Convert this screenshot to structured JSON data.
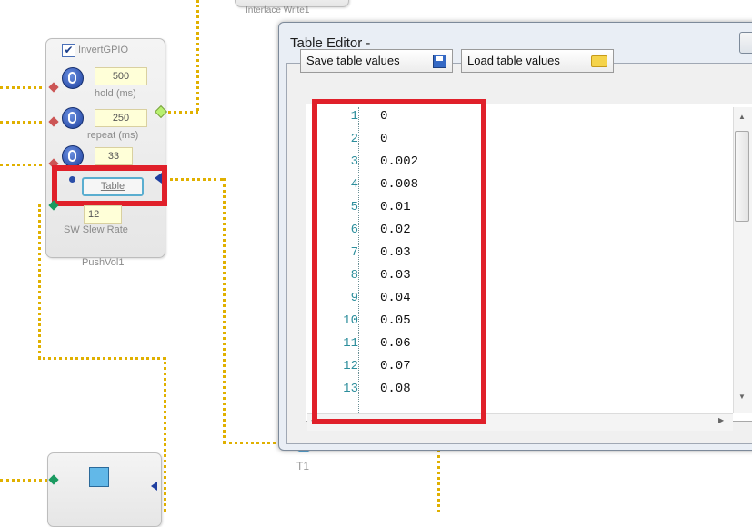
{
  "canvas": {
    "top_module_label": "Interface Write1",
    "pushvol": {
      "checkbox_label": "InvertGPIO",
      "checked": true,
      "hold_value": "500",
      "hold_label": "hold (ms)",
      "repeat_value": "250",
      "repeat_label": "repeat (ms)",
      "third_value": "33",
      "table_button_label": "Table",
      "slew_value": "12",
      "slew_label": "SW Slew Rate",
      "module_name": "PushVol1"
    },
    "t1_label": "T1"
  },
  "table_editor": {
    "title": "Table Editor -",
    "save_button_label": "Save table values",
    "load_button_label": "Load table values",
    "rows": [
      {
        "line": "1",
        "value": "0"
      },
      {
        "line": "2",
        "value": "0"
      },
      {
        "line": "3",
        "value": "0.002"
      },
      {
        "line": "4",
        "value": "0.008"
      },
      {
        "line": "5",
        "value": "0.01"
      },
      {
        "line": "6",
        "value": "0.02"
      },
      {
        "line": "7",
        "value": "0.03"
      },
      {
        "line": "8",
        "value": "0.03"
      },
      {
        "line": "9",
        "value": "0.04"
      },
      {
        "line": "10",
        "value": "0.05"
      },
      {
        "line": "11",
        "value": "0.06"
      },
      {
        "line": "12",
        "value": "0.07"
      },
      {
        "line": "13",
        "value": "0.08"
      }
    ]
  },
  "colors": {
    "highlight": "#e0202a",
    "wire": "#e0b000",
    "line_number": "#2d8e9c"
  }
}
